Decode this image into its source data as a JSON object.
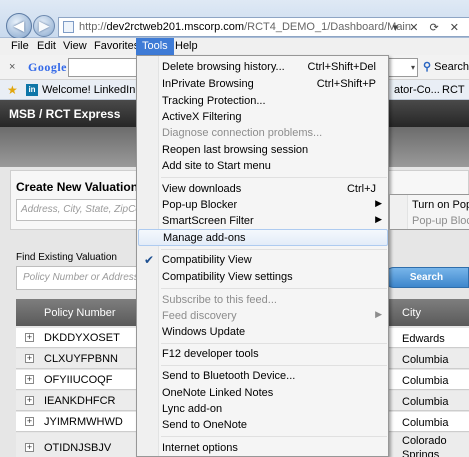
{
  "browser": {
    "address_prefix": "http://",
    "address_host": "dev2rctweb201.mscorp.com",
    "address_path": "/RCT4_DEMO_1/Dashboard/Main",
    "address_controls": "▾ ✕ ⟳ ✕",
    "back_symbol": "◀",
    "forward_symbol": "▶"
  },
  "menubar": {
    "file": "File",
    "edit": "Edit",
    "view": "View",
    "favorites": "Favorites",
    "tools": "Tools",
    "help": "Help"
  },
  "google_toolbar": {
    "close": "×",
    "logo": "Google",
    "search_label": "Search",
    "search_dropdown": "▾"
  },
  "favorites_bar": {
    "star": "★",
    "linkedin_icon": "in",
    "linkedin_link": "Welcome! LinkedIn",
    "right_item_1": "ator-Co...",
    "right_item_2": "RCT"
  },
  "app": {
    "title": "MSB / RCT Express",
    "create_title": "Create New Valuation",
    "create_placeholder": "Address, City, State, ZipCode",
    "find_label": "Find Existing Valuation",
    "find_placeholder": "Policy Number or Address",
    "search_button": "Search",
    "grid": {
      "col_policy": "Policy Number",
      "col_city": "City",
      "expander": "+",
      "rows": [
        {
          "policy": "DKDDYXOSET",
          "city": "Edwards"
        },
        {
          "policy": "CLXUYFPBNN",
          "city": "Columbia"
        },
        {
          "policy": "OFYIIUCOQF",
          "city": "Columbia"
        },
        {
          "policy": "IEANKDHFCR",
          "city": "Columbia"
        },
        {
          "policy": "JYIMRMWHWD",
          "city": "Columbia"
        },
        {
          "policy": "OTIDNJSBJV",
          "city": "Colorado Springs"
        }
      ]
    }
  },
  "tools_menu": {
    "items": [
      {
        "label": "Delete browsing history...",
        "shortcut": "Ctrl+Shift+Del"
      },
      {
        "label": "InPrivate Browsing",
        "shortcut": "Ctrl+Shift+P"
      },
      {
        "label": "Tracking Protection..."
      },
      {
        "label": "ActiveX Filtering"
      },
      {
        "label": "Diagnose connection problems..."
      },
      {
        "label": "Reopen last browsing session"
      },
      {
        "label": "Add site to Start menu"
      },
      {
        "label": "View downloads",
        "shortcut": "Ctrl+J"
      },
      {
        "label": "Pop-up Blocker"
      },
      {
        "label": "SmartScreen Filter"
      },
      {
        "label": "Manage add-ons"
      },
      {
        "label": "Compatibility View"
      },
      {
        "label": "Compatibility View settings"
      },
      {
        "label": "Subscribe to this feed..."
      },
      {
        "label": "Feed discovery"
      },
      {
        "label": "Windows Update"
      },
      {
        "label": "F12 developer tools"
      },
      {
        "label": "Send to Bluetooth Device..."
      },
      {
        "label": "OneNote Linked Notes"
      },
      {
        "label": "Lync add-on"
      },
      {
        "label": "Send to OneNote"
      },
      {
        "label": "Internet options"
      }
    ],
    "submenu_arrow": "▶",
    "check_mark": "✔"
  },
  "popup_submenu": {
    "turn_on": "Turn on Pop-up",
    "settings": "Pop-up Blocker"
  }
}
